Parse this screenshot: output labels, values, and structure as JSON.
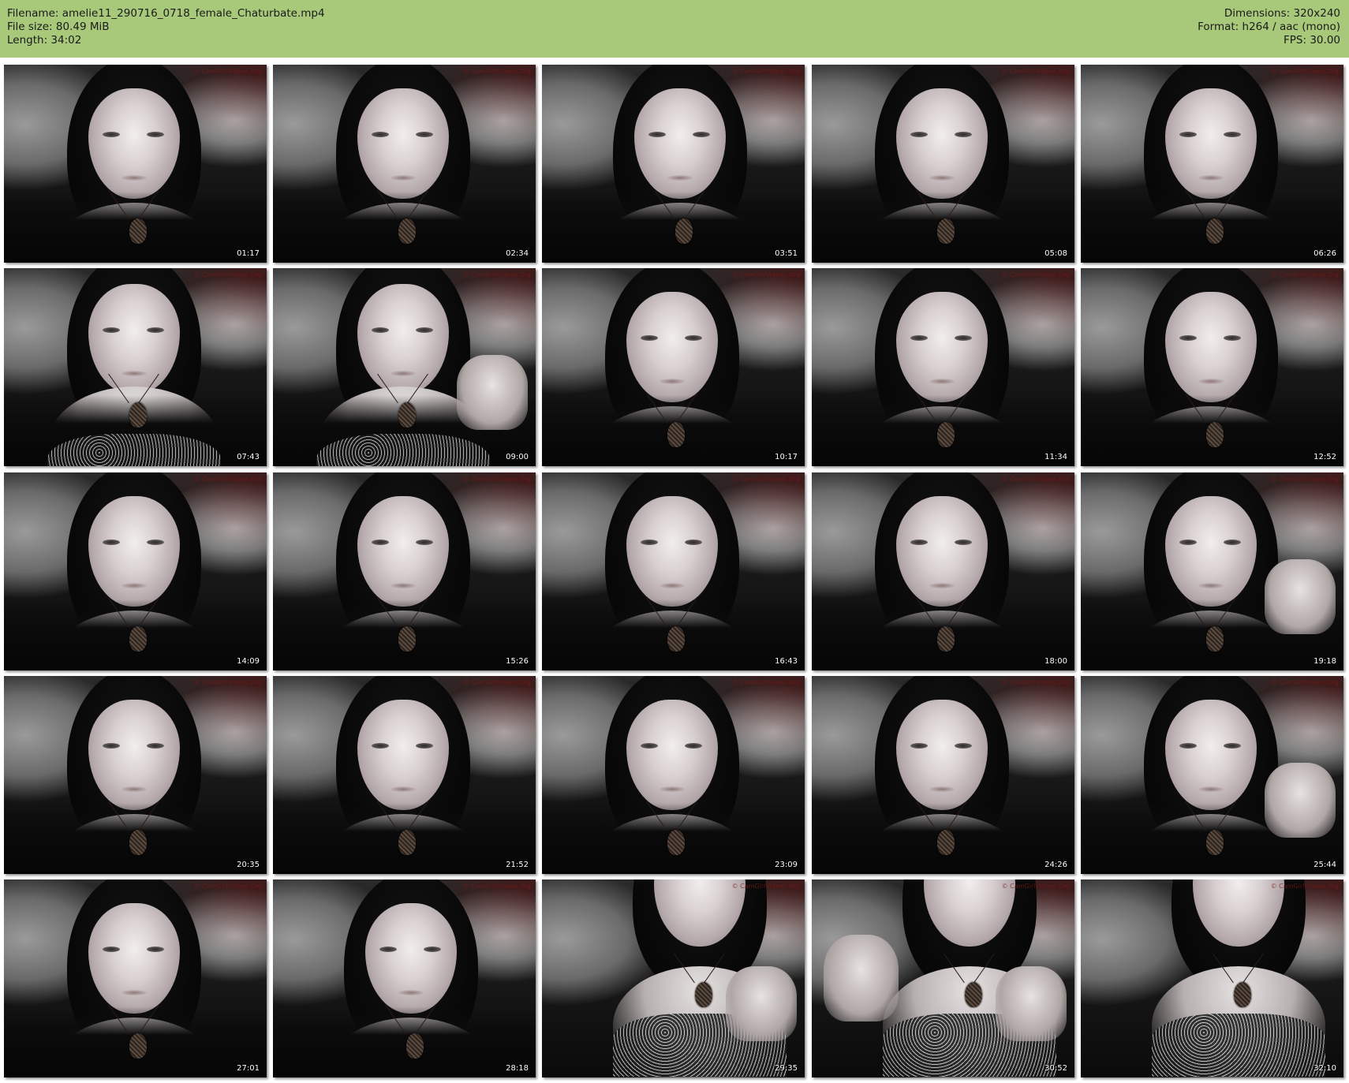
{
  "header": {
    "filename": "Filename: amelie11_290716_0718_female_Chaturbate.mp4",
    "file_size": "File size: 80.49 MiB",
    "length": "Length: 34:02",
    "dimensions": "Dimensions: 320x240",
    "format": "Format: h264 / aac (mono)",
    "fps": "FPS: 30.00"
  },
  "colors": {
    "header_bg": "#a8c97a",
    "page_bg": "#ffffff"
  },
  "thumbnails": [
    {
      "timestamp": "01:17",
      "variant": "face"
    },
    {
      "timestamp": "02:34",
      "variant": "face"
    },
    {
      "timestamp": "03:51",
      "variant": "face-tilted"
    },
    {
      "timestamp": "05:08",
      "variant": "face"
    },
    {
      "timestamp": "06:26",
      "variant": "face"
    },
    {
      "timestamp": "07:43",
      "variant": "lace"
    },
    {
      "timestamp": "09:00",
      "variant": "lace-hand"
    },
    {
      "timestamp": "10:17",
      "variant": "face"
    },
    {
      "timestamp": "11:34",
      "variant": "face"
    },
    {
      "timestamp": "12:52",
      "variant": "face"
    },
    {
      "timestamp": "14:09",
      "variant": "face"
    },
    {
      "timestamp": "15:26",
      "variant": "face"
    },
    {
      "timestamp": "16:43",
      "variant": "face"
    },
    {
      "timestamp": "18:00",
      "variant": "face"
    },
    {
      "timestamp": "19:18",
      "variant": "face-hand"
    },
    {
      "timestamp": "20:35",
      "variant": "face"
    },
    {
      "timestamp": "21:52",
      "variant": "face"
    },
    {
      "timestamp": "23:09",
      "variant": "face"
    },
    {
      "timestamp": "24:26",
      "variant": "face"
    },
    {
      "timestamp": "25:44",
      "variant": "face-hand"
    },
    {
      "timestamp": "27:01",
      "variant": "face"
    },
    {
      "timestamp": "28:18",
      "variant": "face-tilted"
    },
    {
      "timestamp": "29:35",
      "variant": "chest-hand"
    },
    {
      "timestamp": "30:52",
      "variant": "chest-hands"
    },
    {
      "timestamp": "32:10",
      "variant": "chest"
    }
  ]
}
